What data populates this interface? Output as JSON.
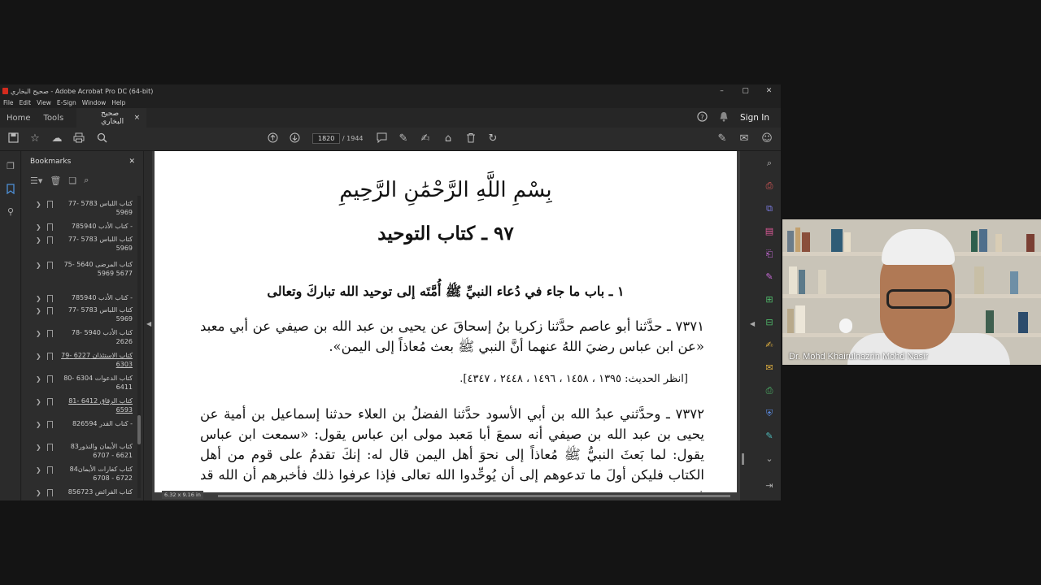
{
  "window": {
    "title": "صحيح البخاري - Adobe Acrobat Pro DC (64-bit)",
    "controls": [
      "–",
      "▢",
      "✕"
    ]
  },
  "menu": [
    "File",
    "Edit",
    "View",
    "E-Sign",
    "Window",
    "Help"
  ],
  "tabs": {
    "home": "Home",
    "tools": "Tools",
    "document": "صحيح البخاري",
    "close": "×",
    "signin": "Sign In"
  },
  "toolbar": {
    "page_current": "1820",
    "page_total": "/ 1944"
  },
  "bookmarks": {
    "title": "Bookmarks",
    "close": "✕",
    "items": [
      {
        "label": "77كتاب اللباس 5783 - 5969"
      },
      {
        "label": "78كتاب الأدب 5940 -"
      },
      {
        "label": "77كتاب اللباس 5783 - 5969"
      },
      {
        "label": "75كتاب المرضى 5640 - 5677 5969"
      },
      {
        "label": "78كتاب الأدب 5940 -"
      },
      {
        "label": "77كتاب اللباس 5783 - 5969"
      },
      {
        "label": "78كتاب الأدب 5940 - 2626"
      },
      {
        "label": "79كتاب الاستئذان 6227 - 6303"
      },
      {
        "label": "80كتاب الدعوات 6304 - 6411"
      },
      {
        "label": "81كتاب الرقاق 6412 - 6593"
      },
      {
        "label": "82كتاب القدر 6594 -"
      },
      {
        "label": "83كتاب الأيمان والنذور 6621 - 6707"
      },
      {
        "label": "84كتاب كفارات الأيمان 6722 - 6708"
      },
      {
        "label": "85كتاب الفرائض 6723"
      }
    ]
  },
  "document": {
    "basmala": "بِسْمِ اللَّهِ الرَّحْمَٰنِ الرَّحِيمِ",
    "kitab_title": "٩٧ ـ كتاب التوحيد",
    "bab_title": "١ ـ باب ما جاء في دُعاء النبيِّ ﷺ أُمَّتَه إلى توحيد الله تباركَ وتعالى",
    "hadith_7371": "٧٣٧١ ـ حدَّثنا أبو عاصم حدَّثنا زكريا بنُ إسحاقَ عن يحيى بن عبد الله بن صيفي عن أبي معبد «عن ابن عباس رضيَ اللهُ عنهما أنَّ النبي ﷺ بعث مُعاذاً إلى اليمن».",
    "reference": "[انظر الحديث: ١٣٩٥ ، ١٤٥٨ ، ١٤٩٦ ، ٢٤٤٨ ، ٤٣٤٧].",
    "hadith_7372": "٧٣٧٢ ـ وحدَّثني عبدُ الله بن أبي الأسود حدَّثنا الفضلُ بن العلاء حدثنا إسماعيل بن أمية عن يحيى بن عبد الله بن صيفي أنه سمعَ أبا مَعبد مولى ابن عباس يقول: «سمعت ابن عباس يقول: لما بَعثَ النبيُّ ﷺ مُعاذاً إلى نحوَ أهل اليمن قال له: إنكَ تقدمُ على قوم من أهل الكتاب فليكن أولَ ما تدعوهم إلى أن يُوحِّدوا الله تعالى فإذا عرفوا ذلك فأخبرهم أن الله قد فرض",
    "size_info": "6.32 x 9.16 in"
  },
  "video": {
    "speaker_name": "Dr. Mohd Khairulnazrin Mohd Nasir"
  },
  "colors": {
    "accent": "#4d8fd6",
    "app_bg": "#2b2b2b",
    "page_bg": "#ffffff"
  }
}
